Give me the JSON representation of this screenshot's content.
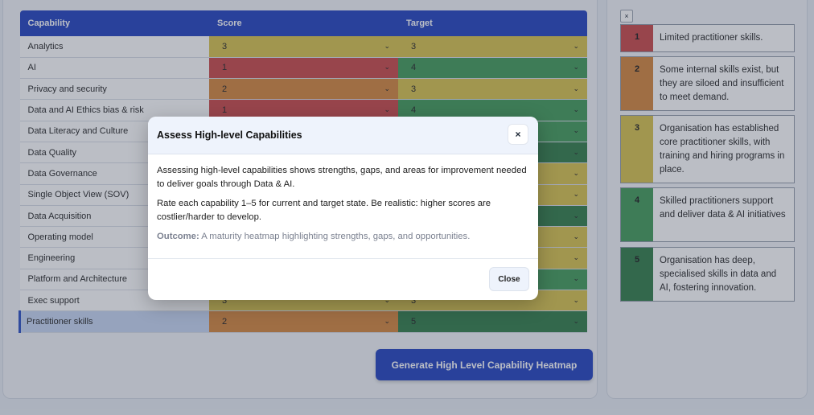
{
  "table": {
    "headers": {
      "capability": "Capability",
      "score": "Score",
      "target": "Target"
    },
    "rows": [
      {
        "name": "Analytics",
        "score": "3",
        "target": "3",
        "score_level": 3,
        "target_level": 3
      },
      {
        "name": "AI",
        "score": "1",
        "target": "4",
        "score_level": 1,
        "target_level": 4
      },
      {
        "name": "Privacy and security",
        "score": "2",
        "target": "3",
        "score_level": 2,
        "target_level": 3
      },
      {
        "name": "Data and AI Ethics bias & risk",
        "score": "1",
        "target": "4",
        "score_level": 1,
        "target_level": 4
      },
      {
        "name": "Data Literacy and Culture",
        "score": "",
        "target": "",
        "score_level": 2,
        "target_level": 4
      },
      {
        "name": "Data Quality",
        "score": "",
        "target": "",
        "score_level": 2,
        "target_level": 5
      },
      {
        "name": "Data Governance",
        "score": "",
        "target": "",
        "score_level": 2,
        "target_level": 3
      },
      {
        "name": "Single Object View (SOV)",
        "score": "",
        "target": "",
        "score_level": 2,
        "target_level": 3
      },
      {
        "name": "Data Acquisition",
        "score": "",
        "target": "",
        "score_level": 2,
        "target_level": 5
      },
      {
        "name": "Operating model",
        "score": "",
        "target": "",
        "score_level": 2,
        "target_level": 3
      },
      {
        "name": "Engineering",
        "score": "",
        "target": "",
        "score_level": 2,
        "target_level": 3
      },
      {
        "name": "Platform and Architecture",
        "score": "",
        "target": "",
        "score_level": 2,
        "target_level": 4
      },
      {
        "name": "Exec support",
        "score": "3",
        "target": "3",
        "score_level": 3,
        "target_level": 3
      },
      {
        "name": "Practitioner skills",
        "score": "2",
        "target": "5",
        "score_level": 2,
        "target_level": 5,
        "selected": true
      }
    ]
  },
  "generate_button": "Generate High Level Capability Heatmap",
  "legend": {
    "close_label": "×",
    "items": [
      {
        "num": "1",
        "level": 1,
        "text": "Limited practitioner skills."
      },
      {
        "num": "2",
        "level": 2,
        "text": "Some internal skills exist, but they are siloed and insufficient to meet demand."
      },
      {
        "num": "3",
        "level": 3,
        "text": "Organisation has established core practitioner skills, with training and hiring programs in place."
      },
      {
        "num": "4",
        "level": 4,
        "text": "Skilled practitioners support and deliver data & AI initiatives"
      },
      {
        "num": "5",
        "level": 5,
        "text": "Organisation has deep, specialised skills in data and AI, fostering innovation."
      }
    ]
  },
  "modal": {
    "title": "Assess High-level Capabilities",
    "close_x": "×",
    "para1": "Assessing high-level capabilities shows strengths, gaps, and areas for improvement needed to deliver goals through Data & AI.",
    "para2": "Rate each capability 1–5 for current and target state. Be realistic: higher scores are costlier/harder to develop.",
    "outcome_label": "Outcome:",
    "outcome_text": " A maturity heatmap highlighting strengths, gaps, and opportunities.",
    "close_button": "Close"
  },
  "icons": {
    "dropdown": "chevron-down-icon",
    "close": "close-icon"
  },
  "colors": {
    "accent": "#1f3fbf",
    "level1": "#c94545",
    "level2": "#d4843a",
    "level3": "#d8c24a",
    "level4": "#3f9a56",
    "level5": "#2f7b45"
  }
}
